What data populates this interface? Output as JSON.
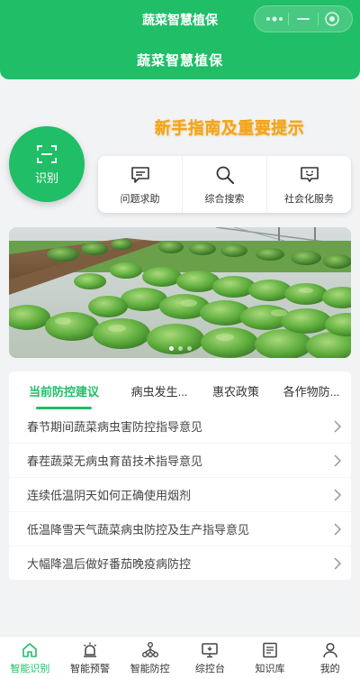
{
  "app": {
    "mini_title": "蔬菜智慧植保",
    "page_title": "蔬菜智慧植保"
  },
  "capsule": {
    "more_icon": "more-dots-icon",
    "minimize_icon": "minimize-icon",
    "close_icon": "target-close-icon"
  },
  "notice": "新手指南及重要提示",
  "identify": {
    "label": "识别",
    "icon": "scan-icon"
  },
  "quick_actions": [
    {
      "label": "问题求助",
      "icon": "chat-bubble-icon"
    },
    {
      "label": "综合搜索",
      "icon": "search-icon"
    },
    {
      "label": "社会化服务",
      "icon": "smile-chat-icon"
    }
  ],
  "banner": {
    "slides": 3,
    "active": 1
  },
  "tabs": [
    {
      "label": "当前防控建议",
      "active": true
    },
    {
      "label": "病虫发生...",
      "active": false
    },
    {
      "label": "惠农政策",
      "active": false
    },
    {
      "label": "各作物防...",
      "active": false
    }
  ],
  "list": [
    "春节期间蔬菜病虫害防控指导意见",
    "春茬蔬菜无病虫育苗技术指导意见",
    "连续低温阴天如何正确使用烟剂",
    "低温降雪天气蔬菜病虫防控及生产指导意见",
    "大幅降温后做好番茄晚疫病防控"
  ],
  "nav": [
    {
      "label": "智能识别",
      "icon": "home-icon",
      "active": true
    },
    {
      "label": "智能预警",
      "icon": "alarm-icon",
      "active": false
    },
    {
      "label": "智能防控",
      "icon": "network-icon",
      "active": false
    },
    {
      "label": "综控台",
      "icon": "monitor-icon",
      "active": false
    },
    {
      "label": "知识库",
      "icon": "book-icon",
      "active": false
    },
    {
      "label": "我的",
      "icon": "user-icon",
      "active": false
    }
  ],
  "colors": {
    "brand": "#1fbe67",
    "notice": "#f4a31c",
    "background": "#f2f3f5"
  }
}
